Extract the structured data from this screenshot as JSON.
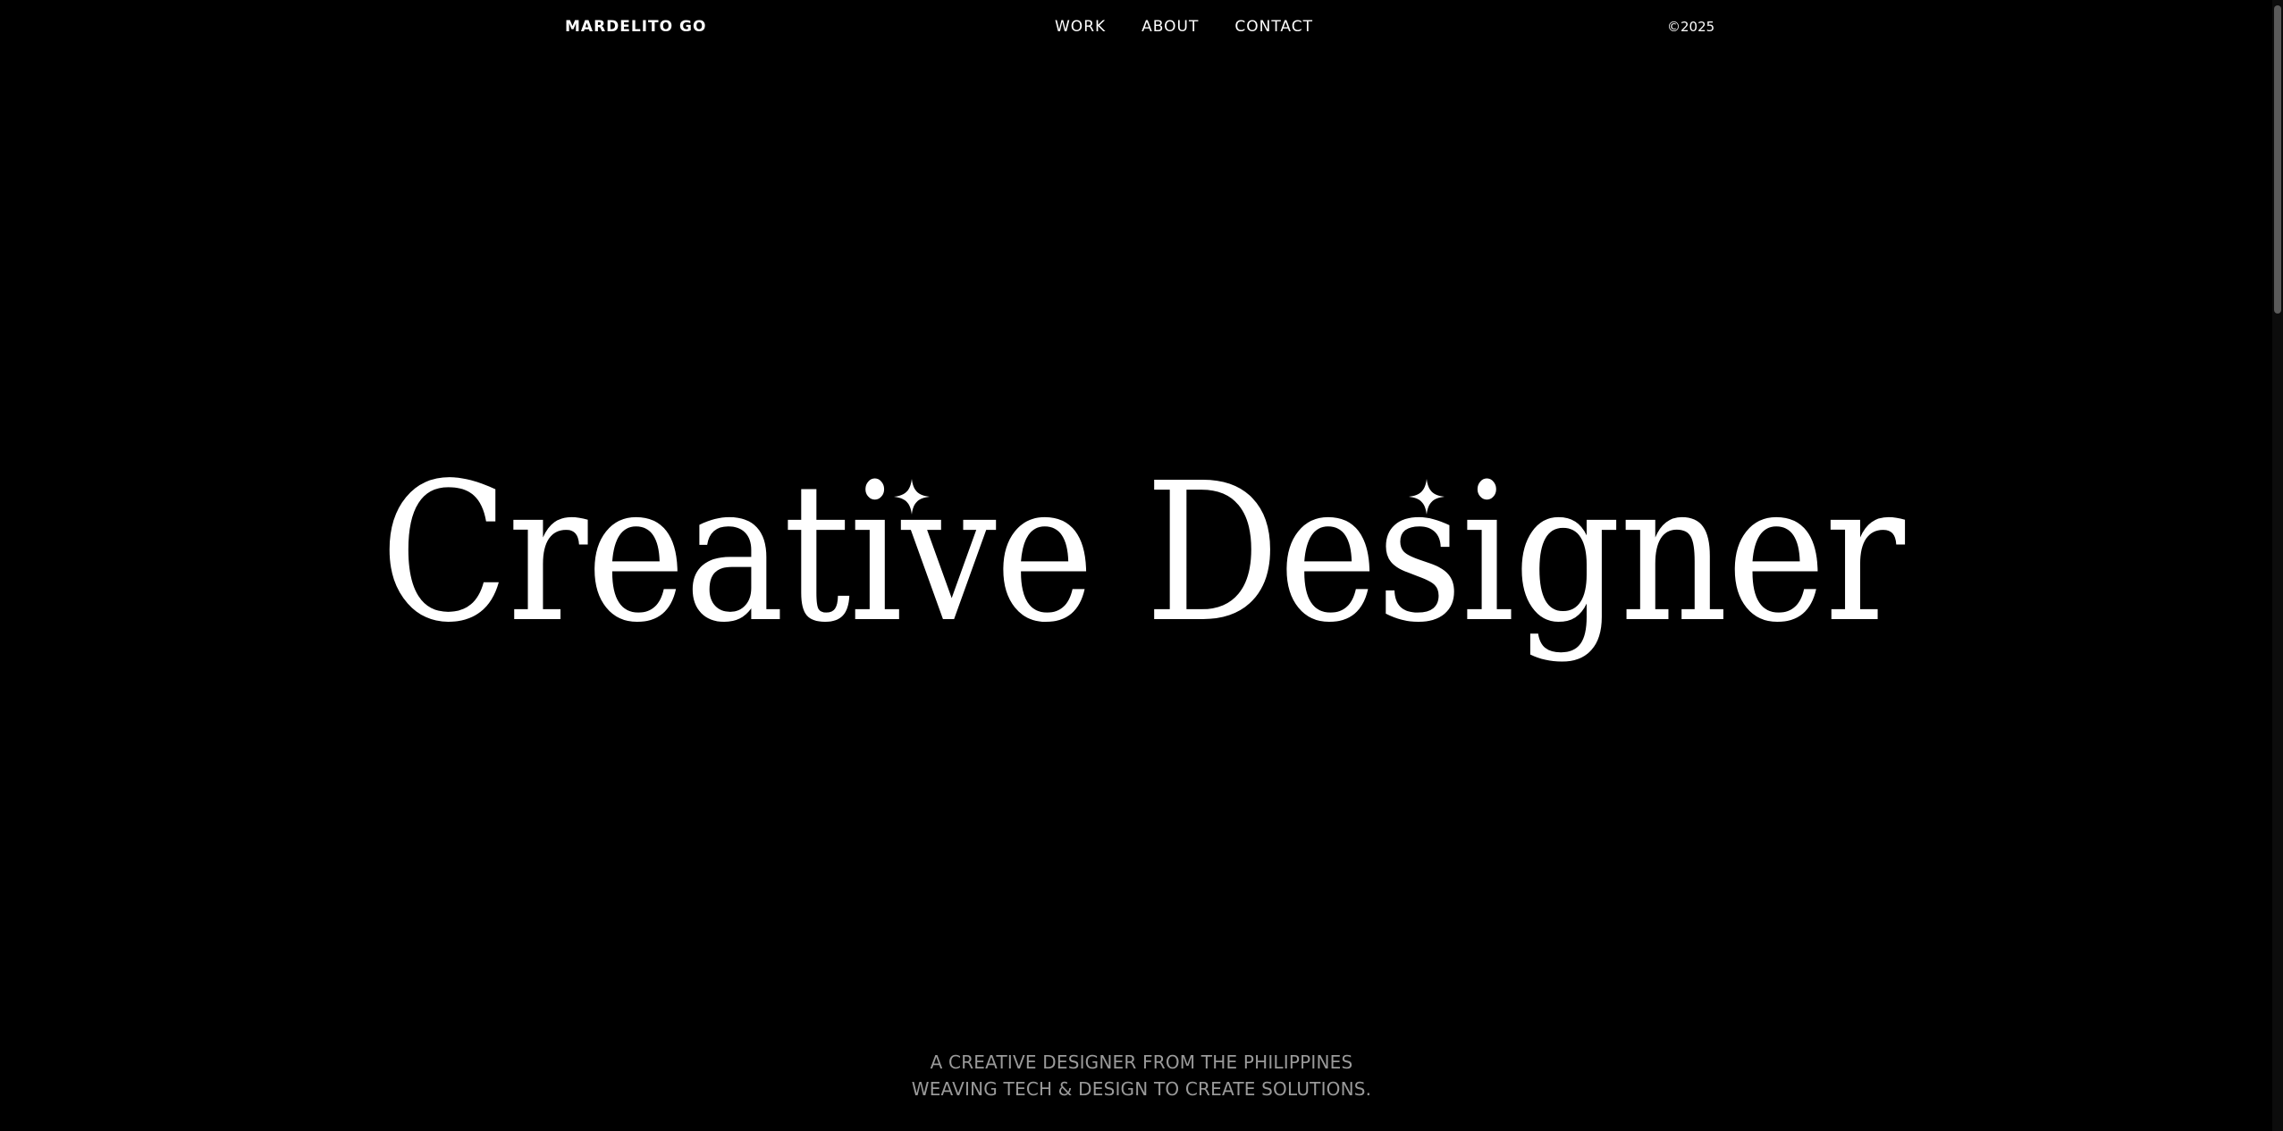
{
  "header": {
    "brand": "MARDELITO GO",
    "nav": [
      {
        "label": "WORK"
      },
      {
        "label": "ABOUT"
      },
      {
        "label": "CONTACT"
      }
    ],
    "copyright": "©2025"
  },
  "hero": {
    "title": "Creative Designer"
  },
  "tagline": {
    "line1": "A CREATIVE DESIGNER FROM THE PHILIPPINES",
    "line2": "WEAVING TECH & DESIGN TO CREATE SOLUTIONS."
  },
  "colors": {
    "background": "#000000",
    "text": "#ffffff",
    "muted": "#9a9a9a"
  },
  "icons": {
    "sparkle": "four-point-star-icon"
  }
}
